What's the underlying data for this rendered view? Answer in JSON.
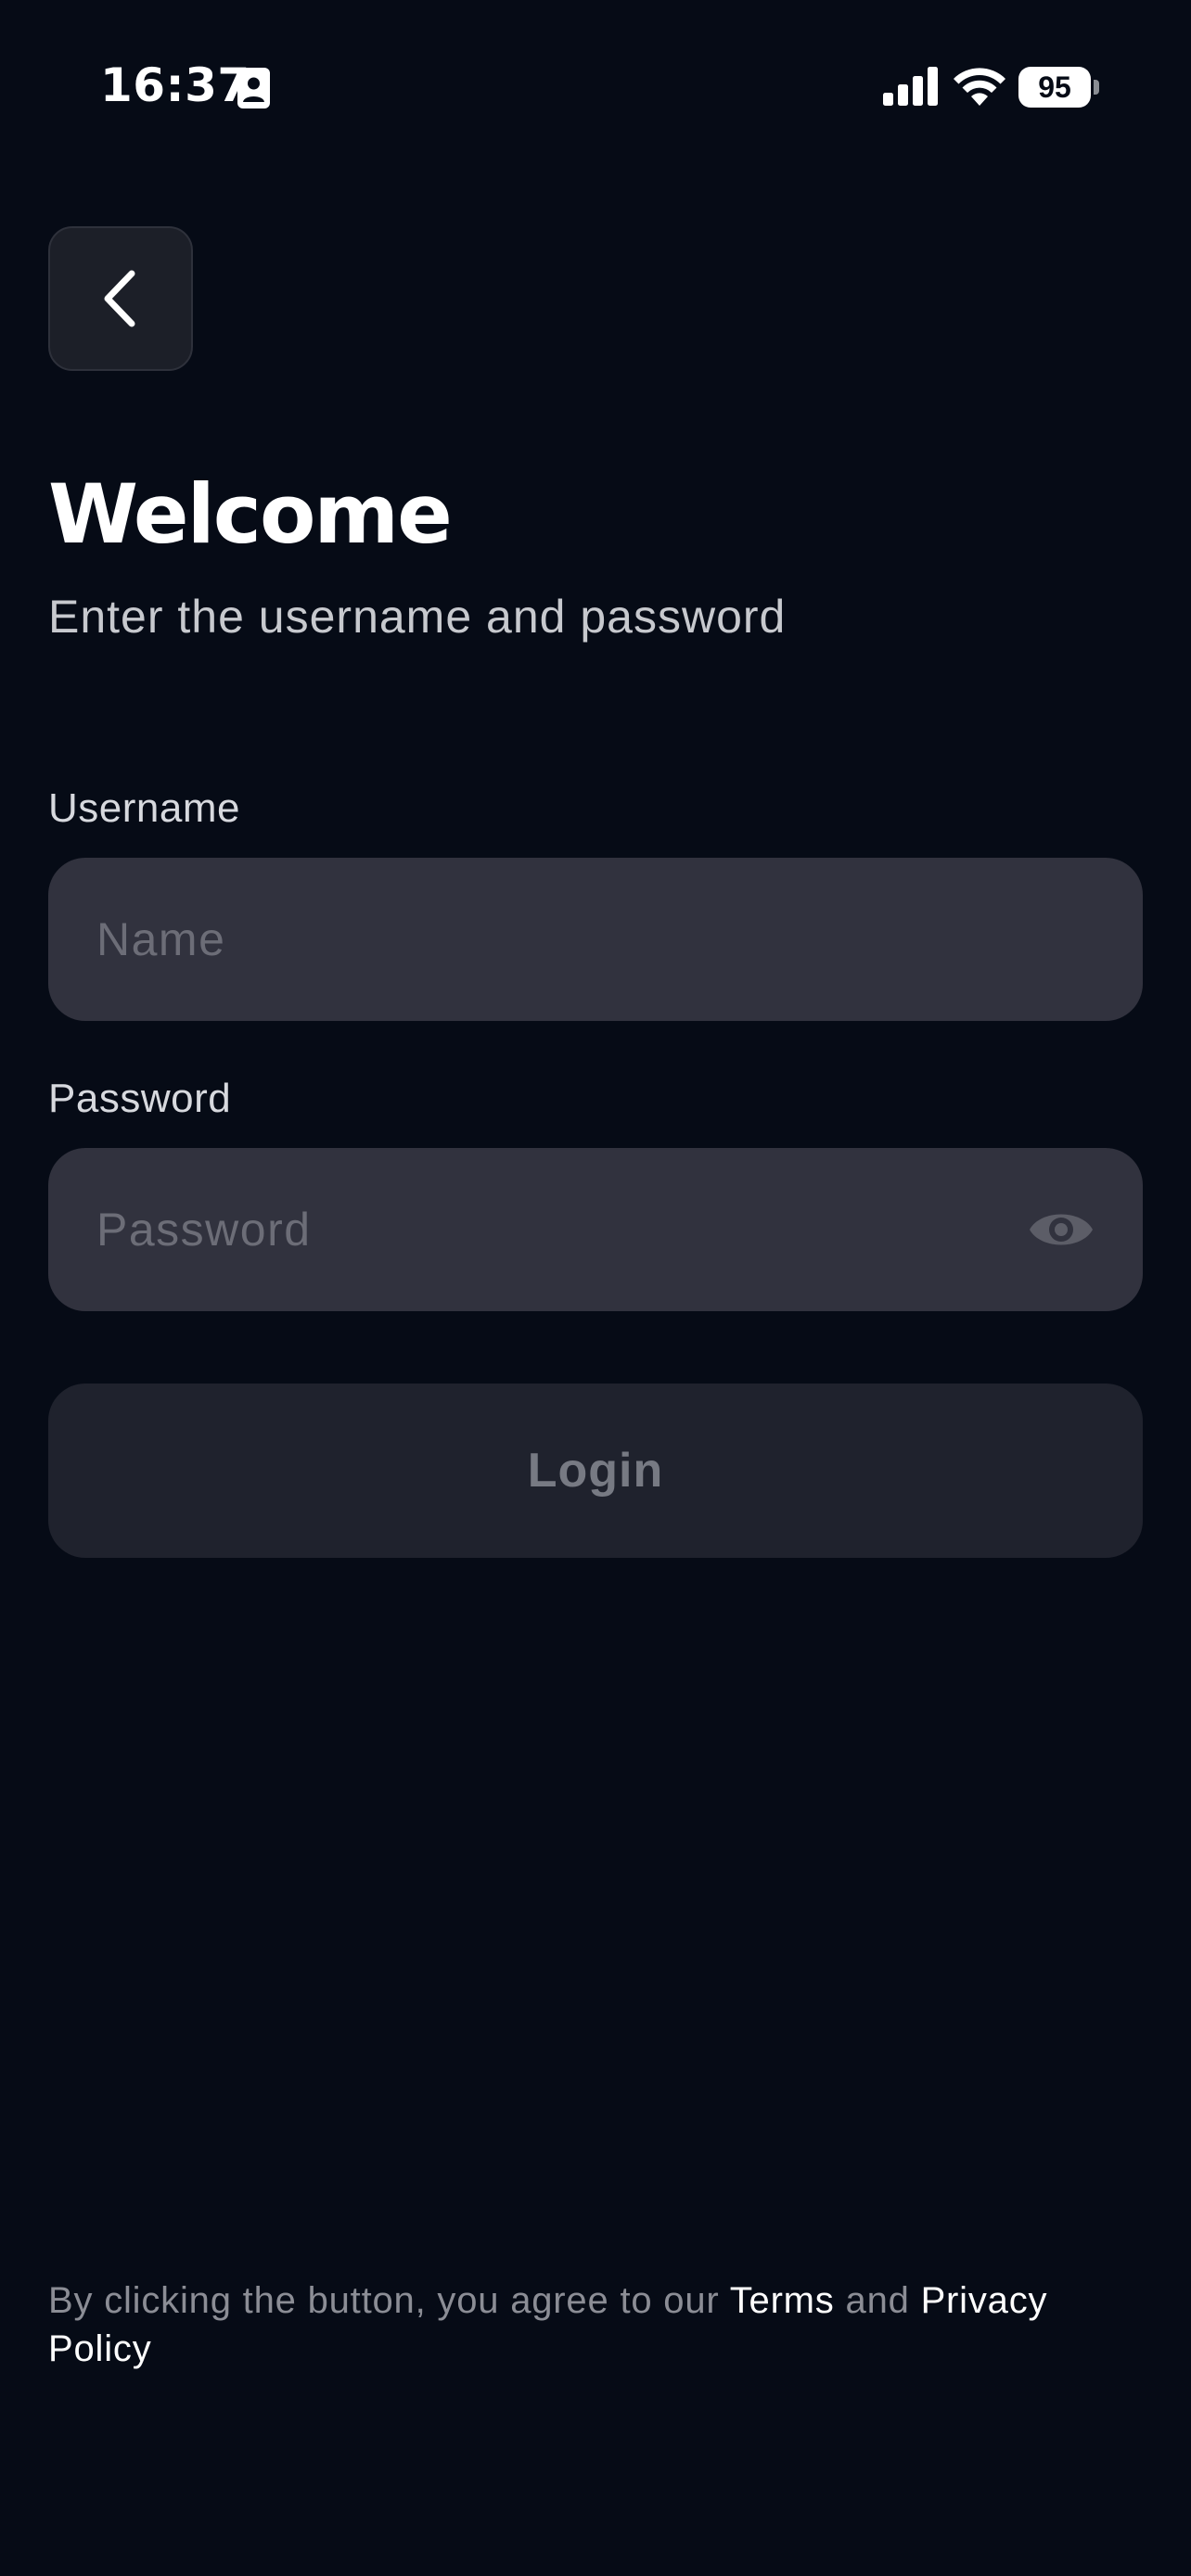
{
  "status_bar": {
    "time": "16:37",
    "battery": "95",
    "contact_icon": "contact-card-icon",
    "signal_icon": "cellular-signal-icon",
    "wifi_icon": "wifi-icon"
  },
  "header": {
    "back_icon": "chevron-left-icon"
  },
  "main": {
    "title": "Welcome",
    "subtitle": "Enter the username and password"
  },
  "form": {
    "username_label": "Username",
    "username_value": "",
    "username_placeholder": "Name",
    "password_label": "Password",
    "password_value": "",
    "password_placeholder": "Password",
    "password_toggle_icon": "eye-icon",
    "login_label": "Login"
  },
  "footer": {
    "prefix": "By clicking the button, you agree to our ",
    "terms_link": "Terms",
    "middle": " and ",
    "privacy_link": "Privacy Policy"
  },
  "colors": {
    "background": "#060b16",
    "input_background": "#31323e",
    "button_background": "#1f222d",
    "button_text": "#777a83",
    "placeholder": "#6c6d77"
  }
}
